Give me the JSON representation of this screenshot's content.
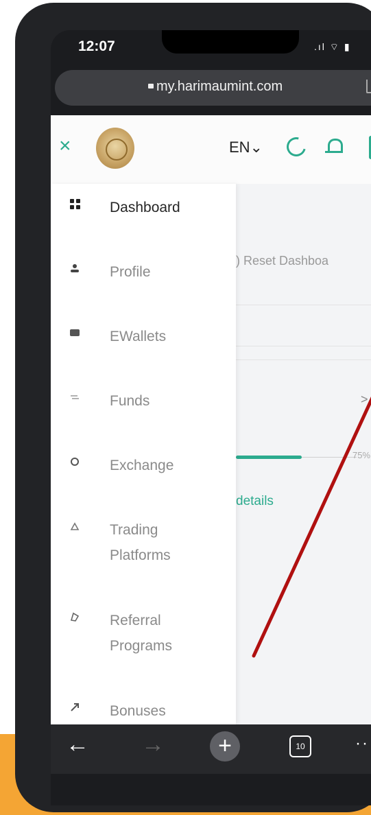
{
  "status_bar": {
    "time": "12:07",
    "icons": ".ıl ⌔ ▮"
  },
  "browser": {
    "url": "my.harimaumint.com"
  },
  "header": {
    "close_glyph": "×",
    "language": "EN⌄"
  },
  "sidebar": {
    "items": [
      {
        "label": "Dashboard",
        "icon": "grid-icon",
        "active": true
      },
      {
        "label": "Profile",
        "icon": "user-icon"
      },
      {
        "label": "EWallets",
        "icon": "wallet-icon"
      },
      {
        "label": "Funds",
        "icon": "funds-icon"
      },
      {
        "label": "Exchange",
        "icon": "exchange-icon"
      },
      {
        "label": "Trading Platforms",
        "icon": "platform-icon"
      },
      {
        "label": "Referral Programs",
        "icon": "referral-icon"
      },
      {
        "label": "Bonuses",
        "icon": "bonus-icon"
      }
    ]
  },
  "main": {
    "reset_label": ") Reset Dashboa",
    "chevron": ">",
    "progress_pct": "75%",
    "details_link": "details"
  },
  "navbar": {
    "back": "←",
    "forward": "→",
    "add": "+",
    "tabs_count": "10",
    "more": "··"
  },
  "colors": {
    "accent": "#2cab8e",
    "annotation": "#b01010",
    "orange": "#f4a534"
  }
}
